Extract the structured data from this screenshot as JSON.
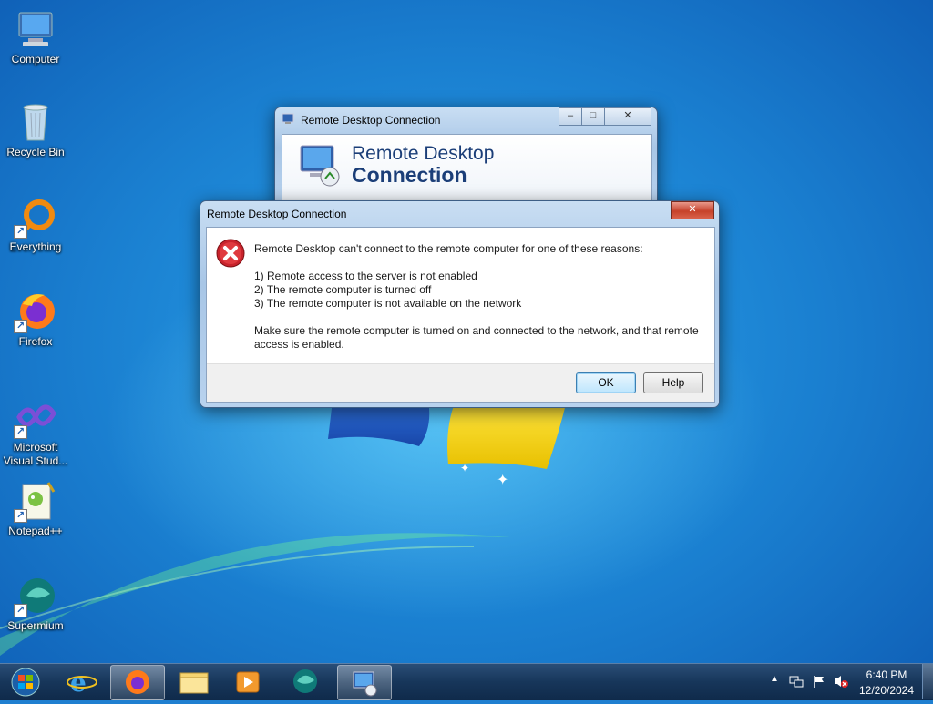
{
  "desktop_icons": [
    {
      "label": "Computer",
      "icon": "computer-icon",
      "shortcut": false
    },
    {
      "label": "Recycle Bin",
      "icon": "recycle-bin-icon",
      "shortcut": false
    },
    {
      "label": "Everything",
      "icon": "everything-icon",
      "shortcut": true
    },
    {
      "label": "Firefox",
      "icon": "firefox-icon",
      "shortcut": true
    },
    {
      "label": "Microsoft Visual Stud...",
      "icon": "visual-studio-icon",
      "shortcut": true
    },
    {
      "label": "Notepad++",
      "icon": "notepadpp-icon",
      "shortcut": true
    },
    {
      "label": "Supermium",
      "icon": "supermium-icon",
      "shortcut": true
    }
  ],
  "rdc_window": {
    "title": "Remote Desktop Connection",
    "banner_line1": "Remote Desktop",
    "banner_line2": "Connection",
    "minimize": "–",
    "maximize": "□",
    "close": "✕"
  },
  "error_dialog": {
    "title": "Remote Desktop Connection",
    "close": "✕",
    "message_intro": "Remote Desktop can't connect to the remote computer for one of these reasons:",
    "reasons": [
      "1) Remote access to the server is not enabled",
      "2) The remote computer is turned off",
      "3) The remote computer is not available on the network"
    ],
    "advice_line1": "Make sure the remote computer is turned on and connected to the network, and that remote",
    "advice_line2": "access is enabled.",
    "ok_label": "OK",
    "help_label": "Help"
  },
  "taskbar": {
    "items": [
      "start-orb",
      "internet-explorer-icon",
      "firefox-icon",
      "file-explorer-icon",
      "media-player-icon",
      "supermium-icon",
      "remote-desktop-icon"
    ],
    "active_item": "remote-desktop-icon",
    "tray": {
      "show_hidden": "▲",
      "time": "6:40 PM",
      "date": "12/20/2024"
    }
  },
  "colors": {
    "desktop_blue": "#1a7fd0",
    "error_red": "#c8232c",
    "taskbar": "#17365a"
  }
}
